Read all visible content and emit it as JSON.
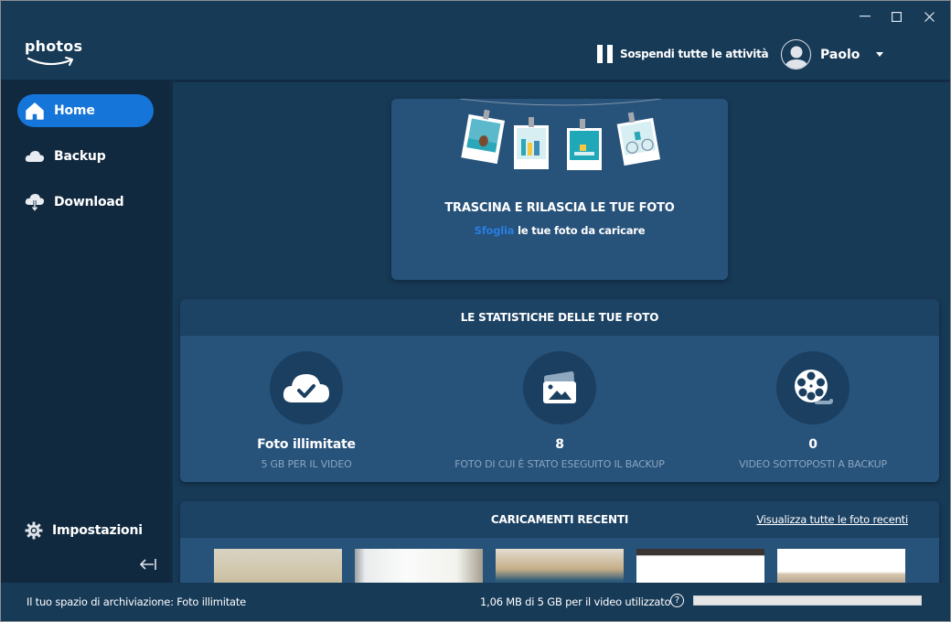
{
  "app": {
    "logo_text": "photos"
  },
  "window_controls": {
    "minimize": "minimize",
    "maximize": "maximize",
    "close": "close"
  },
  "header": {
    "pause_label": "Sospendi tutte le attività",
    "user_name": "Paolo"
  },
  "sidebar": {
    "items": [
      {
        "label": "Home",
        "icon": "home-icon",
        "active": true
      },
      {
        "label": "Backup",
        "icon": "cloud-icon",
        "active": false
      },
      {
        "label": "Download",
        "icon": "cloud-download-icon",
        "active": false
      }
    ],
    "settings_label": "Impostazioni"
  },
  "dropzone": {
    "title": "TRASCINA E RILASCIA LE TUE FOTO",
    "browse_link": "Sfoglia",
    "subtitle_rest": " le tue foto da caricare"
  },
  "stats": {
    "title": "LE STATISTICHE DELLE TUE FOTO",
    "items": [
      {
        "icon": "cloud-check-icon",
        "value": "Foto illimitate",
        "label": "5 GB PER IL VIDEO"
      },
      {
        "icon": "photo-icon",
        "value": "8",
        "label": "FOTO DI CUI È STATO ESEGUITO IL BACKUP"
      },
      {
        "icon": "film-reel-icon",
        "value": "0",
        "label": "VIDEO SOTTOPOSTI A BACKUP"
      }
    ]
  },
  "recent": {
    "title": "CARICAMENTI RECENTI",
    "view_all": "Visualizza tutte le foto recenti",
    "thumbnails": [
      "sky photo",
      "window photo",
      "car photo",
      "screenshot",
      "room photo"
    ]
  },
  "statusbar": {
    "storage": "Il tuo spazio di archiviazione: Foto illimitate",
    "usage": "1,06 MB di 5 GB per il video utilizzato",
    "help": "?",
    "usage_percent": 0.02
  }
}
